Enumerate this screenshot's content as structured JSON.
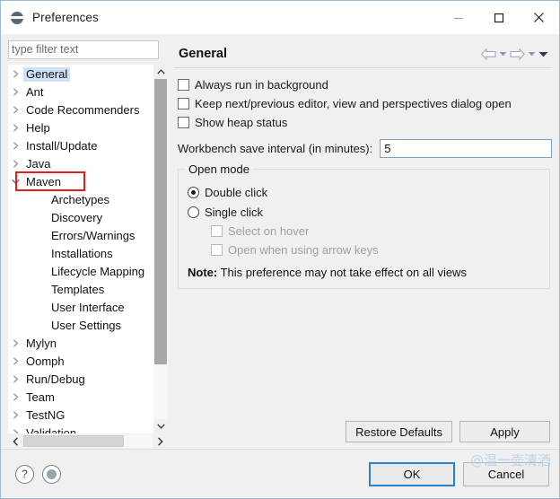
{
  "window": {
    "title": "Preferences",
    "icon": "preferences-disc-icon",
    "controls": {
      "minimize": "minimize-icon",
      "maximize": "maximize-icon",
      "close": "close-icon"
    }
  },
  "sidebar": {
    "filter": {
      "value": "",
      "placeholder": "type filter text"
    },
    "tree": [
      {
        "label": "General",
        "level": 0,
        "expandable": true,
        "expanded": false,
        "selected": true,
        "annotated": false
      },
      {
        "label": "Ant",
        "level": 0,
        "expandable": true,
        "expanded": false,
        "selected": false,
        "annotated": false
      },
      {
        "label": "Code Recommenders",
        "level": 0,
        "expandable": true,
        "expanded": false,
        "selected": false,
        "annotated": false
      },
      {
        "label": "Help",
        "level": 0,
        "expandable": true,
        "expanded": false,
        "selected": false,
        "annotated": false
      },
      {
        "label": "Install/Update",
        "level": 0,
        "expandable": true,
        "expanded": false,
        "selected": false,
        "annotated": false
      },
      {
        "label": "Java",
        "level": 0,
        "expandable": true,
        "expanded": false,
        "selected": false,
        "annotated": false
      },
      {
        "label": "Maven",
        "level": 0,
        "expandable": true,
        "expanded": true,
        "selected": false,
        "annotated": true
      },
      {
        "label": "Archetypes",
        "level": 1,
        "expandable": false,
        "expanded": false,
        "selected": false,
        "annotated": false
      },
      {
        "label": "Discovery",
        "level": 1,
        "expandable": false,
        "expanded": false,
        "selected": false,
        "annotated": false
      },
      {
        "label": "Errors/Warnings",
        "level": 1,
        "expandable": false,
        "expanded": false,
        "selected": false,
        "annotated": false
      },
      {
        "label": "Installations",
        "level": 1,
        "expandable": false,
        "expanded": false,
        "selected": false,
        "annotated": false
      },
      {
        "label": "Lifecycle Mapping",
        "level": 1,
        "expandable": false,
        "expanded": false,
        "selected": false,
        "annotated": false
      },
      {
        "label": "Templates",
        "level": 1,
        "expandable": false,
        "expanded": false,
        "selected": false,
        "annotated": false
      },
      {
        "label": "User Interface",
        "level": 1,
        "expandable": false,
        "expanded": false,
        "selected": false,
        "annotated": false
      },
      {
        "label": "User Settings",
        "level": 1,
        "expandable": false,
        "expanded": false,
        "selected": false,
        "annotated": false
      },
      {
        "label": "Mylyn",
        "level": 0,
        "expandable": true,
        "expanded": false,
        "selected": false,
        "annotated": false
      },
      {
        "label": "Oomph",
        "level": 0,
        "expandable": true,
        "expanded": false,
        "selected": false,
        "annotated": false
      },
      {
        "label": "Run/Debug",
        "level": 0,
        "expandable": true,
        "expanded": false,
        "selected": false,
        "annotated": false
      },
      {
        "label": "Team",
        "level": 0,
        "expandable": true,
        "expanded": false,
        "selected": false,
        "annotated": false
      },
      {
        "label": "TestNG",
        "level": 0,
        "expandable": true,
        "expanded": false,
        "selected": false,
        "annotated": false
      },
      {
        "label": "Validation",
        "level": 0,
        "expandable": true,
        "expanded": false,
        "selected": false,
        "annotated": false
      }
    ],
    "scroll": {
      "vertical_thumb_percent": 84,
      "horizontal_thumb_percent": 78
    }
  },
  "page": {
    "title": "General",
    "nav": {
      "back": "back-arrow-icon",
      "back_menu": "chevron-down-icon",
      "forward": "forward-arrow-icon",
      "forward_menu": "chevron-down-icon",
      "view_menu": "chevron-down-icon"
    },
    "checkboxes": [
      {
        "label": "Always run in background",
        "checked": false,
        "disabled": false
      },
      {
        "label": "Keep next/previous editor, view and perspectives dialog open",
        "checked": false,
        "disabled": false
      },
      {
        "label": "Show heap status",
        "checked": false,
        "disabled": false
      }
    ],
    "save_interval": {
      "label": "Workbench save interval (in minutes):",
      "value": "5"
    },
    "open_mode": {
      "legend": "Open mode",
      "radios": [
        {
          "label": "Double click",
          "checked": true
        },
        {
          "label": "Single click",
          "checked": false
        }
      ],
      "sub_checkboxes": [
        {
          "label": "Select on hover",
          "checked": false,
          "disabled": true
        },
        {
          "label": "Open when using arrow keys",
          "checked": false,
          "disabled": true
        }
      ],
      "note_prefix": "Note:",
      "note_text": "This preference may not take effect on all views"
    },
    "buttons": {
      "restore_defaults": "Restore Defaults",
      "apply": "Apply"
    }
  },
  "footer": {
    "help_icon": "help-question-icon",
    "secondary_icon": "preferences-disc-icon",
    "ok": "OK",
    "cancel": "Cancel",
    "watermark": "@温一壶清酒"
  },
  "colors": {
    "accent": "#2f7fd1",
    "annotation": "#e02020",
    "selection": "#cfe2f7",
    "watermark": "#bcd3ea",
    "dialog_bg": "#f0f0f0"
  }
}
